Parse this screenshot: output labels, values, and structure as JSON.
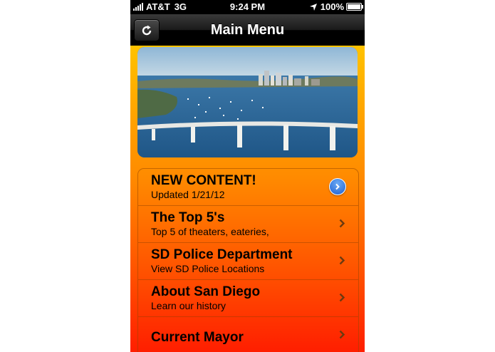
{
  "status_bar": {
    "carrier": "AT&T",
    "network": "3G",
    "time": "9:24 PM",
    "battery": "100%"
  },
  "nav_bar": {
    "title": "Main Menu",
    "refresh_icon": "refresh-icon"
  },
  "hero_image": {
    "subject": "san-diego-bay-bridge-photo"
  },
  "menu": {
    "items": [
      {
        "title": "NEW CONTENT!",
        "subtitle": "Updated 1/21/12",
        "accessory": "detail-disclosure-icon"
      },
      {
        "title": "The Top 5's",
        "subtitle": "Top 5 of theaters, eateries,",
        "accessory": "chevron-right-icon"
      },
      {
        "title": "SD Police Department",
        "subtitle": "View SD Police Locations",
        "accessory": "chevron-right-icon"
      },
      {
        "title": "About San Diego",
        "subtitle": "Learn our history",
        "accessory": "chevron-right-icon"
      },
      {
        "title": "Current Mayor",
        "subtitle": "",
        "accessory": "chevron-right-icon"
      }
    ]
  },
  "colors": {
    "gradient_top": "#ffd800",
    "gradient_bottom": "#ff1e00",
    "navbar": "#000000",
    "disclosure": "#2a6fd8"
  }
}
